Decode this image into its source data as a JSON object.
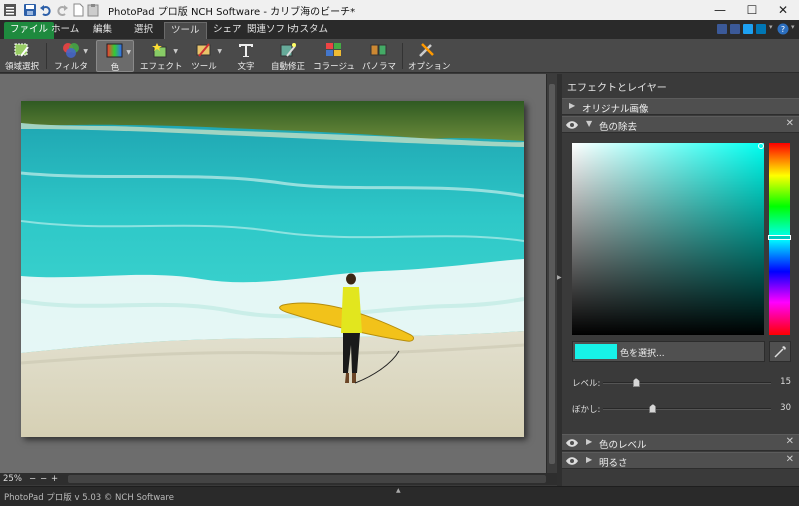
{
  "window": {
    "title": "PhotoPad プロ版 NCH Software - カリブ海のビーチ*",
    "minimize": "—",
    "maximize": "☐",
    "close": "✕"
  },
  "menu_tabs": [
    "ファイル",
    "ホーム",
    "編集",
    "選択",
    "ツール",
    "シェア",
    "関連ソフト",
    "カスタム"
  ],
  "active_tab": "ツール",
  "toolbar": {
    "items": [
      {
        "label": "領域選択",
        "icon": "region-select-icon"
      },
      {
        "label": "フィルタ",
        "icon": "filter-icon"
      },
      {
        "label": "色",
        "icon": "color-icon"
      },
      {
        "label": "エフェクト",
        "icon": "effect-icon"
      },
      {
        "label": "ツール",
        "icon": "tools-icon"
      },
      {
        "label": "文字",
        "icon": "text-icon"
      },
      {
        "label": "自動修正",
        "icon": "auto-fix-icon"
      },
      {
        "label": "コラージュ",
        "icon": "collage-icon"
      },
      {
        "label": "パノラマ",
        "icon": "panorama-icon"
      },
      {
        "label": "オプション",
        "icon": "options-icon"
      }
    ],
    "active": "色"
  },
  "zoom": {
    "value": "25%",
    "minus": "−",
    "slider": "−",
    "plus": "+"
  },
  "status": "PhotoPad プロ版 v 5.03 © NCH Software",
  "panel": {
    "title": "エフェクトとレイヤー",
    "original_layer": "オリジナル画像",
    "color_remove": {
      "label": "色の除去",
      "selected_color": "#17f2e8",
      "pick_label": "色を選択...",
      "level_label": "レベル:",
      "level_value": 15,
      "level_fraction": 0.2,
      "blur_label": "ぼかし:",
      "blur_value": 30,
      "blur_fraction": 0.3
    },
    "color_level": "色のレベル",
    "brightness": "明るさ"
  },
  "colors": {
    "file_tab": "#1e8a3e",
    "accent_cyan": "#17f2e8"
  }
}
